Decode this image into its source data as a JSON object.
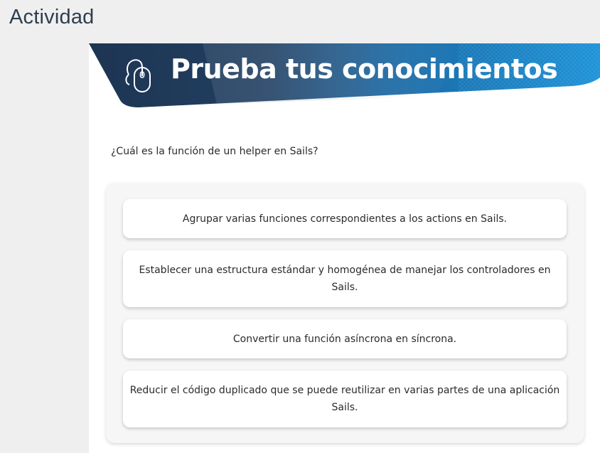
{
  "page": {
    "title": "Actividad"
  },
  "banner": {
    "title": "Prueba tus conocimientos",
    "icon": "mouse-cursor-icon",
    "colors": {
      "dark": "#1e3a5c",
      "accent": "#1f8fd6"
    }
  },
  "quiz": {
    "question": "¿Cuál es la función de un helper en Sails?",
    "options": [
      {
        "label": "Agrupar varias funciones correspondientes a los actions en Sails."
      },
      {
        "label": "Establecer una estructura estándar y homogénea de manejar los controladores en Sails."
      },
      {
        "label": "Convertir una función asíncrona en síncrona."
      },
      {
        "label": "Reducir el código duplicado que se puede reutilizar en varias partes de una aplicación Sails."
      }
    ]
  }
}
